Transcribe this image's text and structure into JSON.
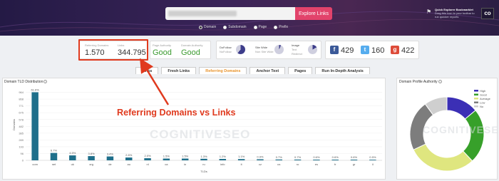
{
  "header": {
    "search": {
      "value": "",
      "placeholder": ""
    },
    "explore_label": "Explore Links",
    "scope_options": [
      {
        "label": "Domain",
        "selected": true
      },
      {
        "label": "Subdomain",
        "selected": false
      },
      {
        "label": "Page",
        "selected": false
      },
      {
        "label": "Prefix",
        "selected": false
      }
    ],
    "bookmarklet_title": "Quick Explorer Bookmarklet",
    "bookmarklet_text": "Drag this icon to your toolbar to run quicker reports",
    "logo_text": "co"
  },
  "metrics": {
    "referring_domains_label": "Referring Domains",
    "referring_domains_value": "1.570",
    "links_label": "Links",
    "links_value": "344.795",
    "page_authority_label": "Page Authority",
    "page_authority_value": "Good",
    "domain_authority_label": "Domain Authority",
    "domain_authority_value": "Good",
    "dofollow_label": "DoFollow",
    "dofollow_sub": "NoFollow",
    "sitewide_label": "Site Wide",
    "sitewide_sub": "Non Site Wide",
    "image_label": "Image",
    "image_sub": "Text",
    "image_sub2": "Redirect",
    "facebook_value": "429",
    "twitter_value": "160",
    "gplus_value": "422",
    "gauges": {
      "dofollow_fraction": 0.61,
      "sitewide_fraction": 0.07,
      "image_fraction": 0.17
    }
  },
  "tabs": [
    {
      "label": "Links",
      "active": false
    },
    {
      "label": "Fresh Links",
      "active": false
    },
    {
      "label": "Referring Domains",
      "active": true
    },
    {
      "label": "Anchor Text",
      "active": false
    },
    {
      "label": "Pages",
      "active": false
    },
    {
      "label": "Run In-Depth Analysis",
      "active": false
    }
  ],
  "annotation": "Referring Domains vs Links",
  "watermark": "COGNITIVESEO",
  "tld_panel_title": "Domain TLD Distribution",
  "authority_panel_title": "Domain Profile Authority",
  "colors": {
    "accent": "#e2436b",
    "annotation": "#e03a1e",
    "bar": "#1f6f8b",
    "good": "#3b9b2f"
  },
  "chart_data": [
    {
      "type": "bar",
      "title": "Domain TLD Distribution",
      "xlabel": "TLDs",
      "ylabel": "Domains",
      "categories": [
        "com",
        "net",
        "uk",
        "org",
        "de",
        "au",
        "nl",
        "ca",
        "in",
        "ru",
        "info",
        "it",
        "cz",
        "us",
        "ro",
        "es",
        "fr",
        "gr",
        "il"
      ],
      "values": [
        965,
        105,
        70,
        60,
        55,
        40,
        30,
        25,
        25,
        22,
        20,
        18,
        15,
        12,
        11,
        10,
        10,
        10,
        9
      ],
      "value_labels": [
        "61.6%",
        "6.7%",
        "4.5%",
        "3.8%",
        "3.4%",
        "2.6%",
        "2.0%",
        "1.5%",
        "1.5%",
        "1.3%",
        "1.2%",
        "1.1%",
        "0.9%",
        "0.7%",
        "0.7%",
        "0.6%",
        "0.6%",
        "0.6%",
        "0.5%"
      ],
      "yticks": [
        "0",
        "96",
        "193",
        "289",
        "385",
        "482",
        "578",
        "675",
        "771",
        "868",
        "964"
      ],
      "ylim": [
        0,
        1010
      ]
    },
    {
      "type": "pie",
      "title": "Domain Profile Authority",
      "labels": [
        "High",
        "Good",
        "Average",
        "Low",
        "No"
      ],
      "values": [
        14,
        24,
        30,
        22,
        10
      ],
      "colors": [
        "#3b2fb5",
        "#37a02a",
        "#dfe67f",
        "#7d7d7d",
        "#cfcfcf"
      ]
    }
  ]
}
